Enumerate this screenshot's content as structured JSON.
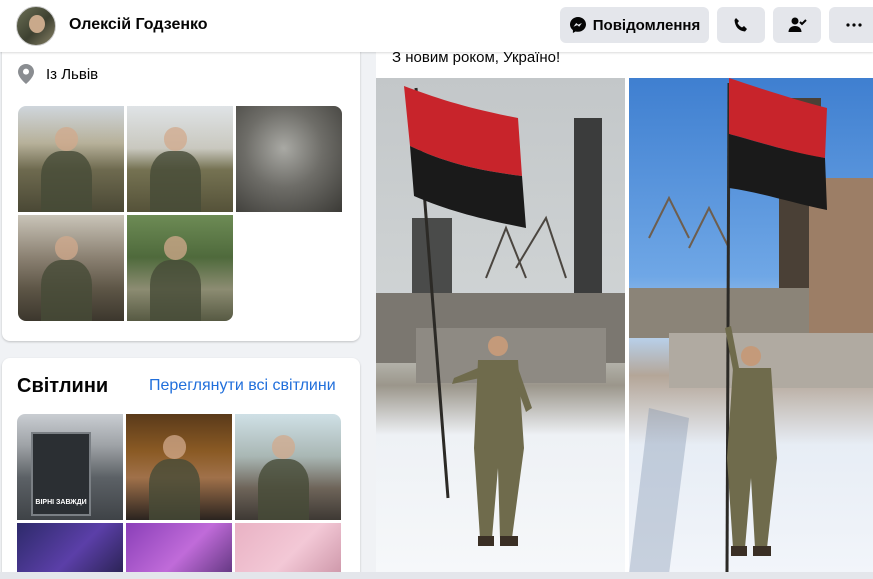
{
  "header": {
    "name": "Олексій Годзенко",
    "message_button": "Повідомлення",
    "icons": [
      "avatar",
      "messenger-icon",
      "phone-icon",
      "friend-check-icon",
      "more-icon"
    ]
  },
  "intro": {
    "location": "Із Львів",
    "location_icon": "location-pin-icon"
  },
  "photos": {
    "title": "Світлини",
    "see_all": "Переглянути всі світлини",
    "poster_text": "ВІРНІ ЗАВЖДИ"
  },
  "post": {
    "text": "З новим роком, Україно!"
  },
  "colors": {
    "link": "#216fdb",
    "flag_red": "#c8242b",
    "flag_black": "#1a1a1a",
    "button_bg": "#e4e6eb"
  }
}
